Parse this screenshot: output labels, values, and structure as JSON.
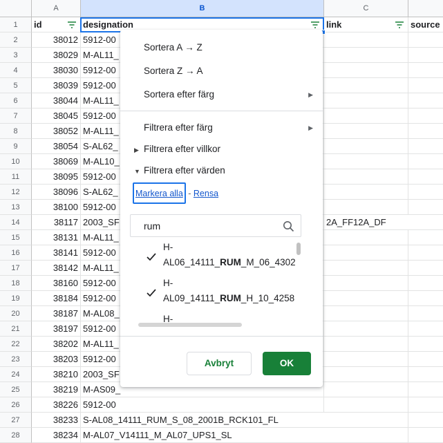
{
  "columns": [
    "A",
    "B",
    "C"
  ],
  "header_row": {
    "row_num": "1",
    "id": "id",
    "designation": "designation",
    "link": "link",
    "source": "source"
  },
  "rows": [
    {
      "num": "2",
      "id": "38012",
      "d": "5912-00"
    },
    {
      "num": "3",
      "id": "38029",
      "d": "M-AL11_"
    },
    {
      "num": "4",
      "id": "38030",
      "d": "5912-00"
    },
    {
      "num": "5",
      "id": "38039",
      "d": "5912-00"
    },
    {
      "num": "6",
      "id": "38044",
      "d": "M-AL11_"
    },
    {
      "num": "7",
      "id": "38045",
      "d": "5912-00"
    },
    {
      "num": "8",
      "id": "38052",
      "d": "M-AL11_"
    },
    {
      "num": "9",
      "id": "38054",
      "d": "S-AL62_"
    },
    {
      "num": "10",
      "id": "38069",
      "d": "M-AL10_"
    },
    {
      "num": "11",
      "id": "38095",
      "d": "5912-00"
    },
    {
      "num": "12",
      "id": "38096",
      "d": "S-AL62_"
    },
    {
      "num": "13",
      "id": "38100",
      "d": "5912-00"
    },
    {
      "num": "14",
      "id": "38117",
      "d": "2003_SF",
      "c": "2A_FF12A_DF"
    },
    {
      "num": "15",
      "id": "38131",
      "d": "M-AL11_"
    },
    {
      "num": "16",
      "id": "38141",
      "d": "5912-00"
    },
    {
      "num": "17",
      "id": "38142",
      "d": "M-AL11_"
    },
    {
      "num": "18",
      "id": "38160",
      "d": "5912-00"
    },
    {
      "num": "19",
      "id": "38184",
      "d": "5912-00"
    },
    {
      "num": "20",
      "id": "38187",
      "d": "M-AL08_"
    },
    {
      "num": "21",
      "id": "38197",
      "d": "5912-00"
    },
    {
      "num": "22",
      "id": "38202",
      "d": "M-AL11_"
    },
    {
      "num": "23",
      "id": "38203",
      "d": "5912-00"
    },
    {
      "num": "24",
      "id": "38210",
      "d": "2003_SF"
    },
    {
      "num": "25",
      "id": "38219",
      "d": "M-AS09_"
    },
    {
      "num": "26",
      "id": "38226",
      "d": "5912-00"
    },
    {
      "num": "27",
      "id": "38233",
      "d": "S-AL08_14111_RUM_S_08_2001B_RCK101_FL"
    },
    {
      "num": "28",
      "id": "38234",
      "d": "M-AL07_V14111_M_AL07_UPS1_SL"
    }
  ],
  "menu": {
    "sort_az": "Sortera A → Z",
    "sort_za": "Sortera Z → A",
    "sort_color": "Sortera efter färg",
    "filter_color": "Filtrera efter färg",
    "filter_condition": "Filtrera efter villkor",
    "filter_values": "Filtrera efter värden",
    "select_all": "Markera alla",
    "link_sep": " - ",
    "clear": "Rensa",
    "search_value": "rum",
    "values": [
      {
        "l1": "H-",
        "pre": "AL06_14111_",
        "match": "RUM",
        "post": "_M_06_4302",
        "checked": true
      },
      {
        "l1": "H-",
        "pre": "AL09_14111_",
        "match": "RUM",
        "post": "_H_10_4258",
        "checked": true
      },
      {
        "l1": "H-",
        "pre": "",
        "match": "",
        "post": "",
        "checked": false
      }
    ],
    "cancel": "Avbryt",
    "ok": "OK"
  },
  "colors": {
    "accent": "#1a73e8",
    "ok_green": "#188038",
    "link_blue": "#1155cc"
  }
}
